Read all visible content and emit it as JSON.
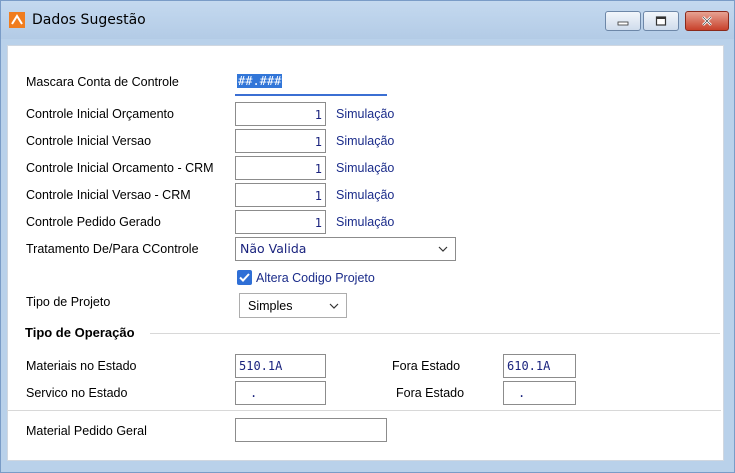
{
  "window": {
    "title": "Dados Sugestão"
  },
  "form": {
    "mascara": {
      "label": "Mascara Conta de Controle",
      "value": "##.###"
    },
    "rows": [
      {
        "label": "Controle Inicial Orçamento",
        "value": "1",
        "link": "Simulação"
      },
      {
        "label": "Controle Inicial Versao",
        "value": "1",
        "link": "Simulação"
      },
      {
        "label": "Controle Inicial Orcamento - CRM",
        "value": "1",
        "link": "Simulação"
      },
      {
        "label": "Controle Inicial Versao - CRM",
        "value": "1",
        "link": "Simulação"
      },
      {
        "label": "Controle Pedido Gerado",
        "value": "1",
        "link": "Simulação"
      }
    ],
    "tratamento": {
      "label": "Tratamento De/Para CControle",
      "value": "Não Valida"
    },
    "altera": {
      "label": "Altera Codigo Projeto",
      "checked": true
    },
    "tipo_projeto": {
      "label": "Tipo de Projeto",
      "value": "Simples"
    },
    "operacao": {
      "heading": "Tipo de Operação",
      "materiais": {
        "label": "Materiais no Estado",
        "value": "510.1A"
      },
      "materiais_fora": {
        "label": "Fora Estado",
        "value": "610.1A"
      },
      "servico": {
        "label": "Servico no Estado",
        "value": "."
      },
      "servico_fora": {
        "label": "Fora Estado",
        "value": "."
      }
    },
    "material_pedido": {
      "label": "Material Pedido Geral",
      "value": ""
    }
  },
  "colors": {
    "link": "#1b2c8a",
    "value": "#1a237e",
    "accent": "#2f6fd6"
  }
}
